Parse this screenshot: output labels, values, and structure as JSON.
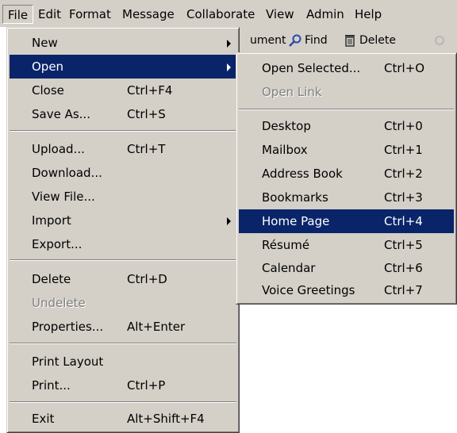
{
  "menubar": {
    "items": [
      "File",
      "Edit",
      "Format",
      "Message",
      "Collaborate",
      "View",
      "Admin",
      "Help"
    ]
  },
  "toolbar": {
    "partial_label": "ument",
    "find_label": "Find",
    "delete_label": "Delete",
    "icons": [
      "find-icon",
      "delete-icon",
      "partial-icon"
    ]
  },
  "file_menu": {
    "groups": [
      [
        {
          "label": "New",
          "shortcut": "",
          "submenu": true
        },
        {
          "label": "Open",
          "shortcut": "",
          "submenu": true,
          "selected": true
        },
        {
          "label": "Close",
          "shortcut": "Ctrl+F4"
        },
        {
          "label": "Save As...",
          "shortcut": "Ctrl+S"
        }
      ],
      [
        {
          "label": "Upload...",
          "shortcut": "Ctrl+T"
        },
        {
          "label": "Download...",
          "shortcut": ""
        },
        {
          "label": "View File...",
          "shortcut": ""
        },
        {
          "label": "Import",
          "shortcut": "",
          "submenu": true
        },
        {
          "label": "Export...",
          "shortcut": ""
        }
      ],
      [
        {
          "label": "Delete",
          "shortcut": "Ctrl+D"
        },
        {
          "label": "Undelete",
          "shortcut": "",
          "disabled": true
        },
        {
          "label": "Properties...",
          "shortcut": "Alt+Enter"
        }
      ],
      [
        {
          "label": "Print Layout",
          "shortcut": ""
        },
        {
          "label": "Print...",
          "shortcut": "Ctrl+P"
        }
      ],
      [
        {
          "label": "Exit",
          "shortcut": "Alt+Shift+F4"
        }
      ]
    ]
  },
  "open_menu": {
    "groups": [
      [
        {
          "label": "Open Selected...",
          "shortcut": "Ctrl+O"
        },
        {
          "label": "Open Link",
          "shortcut": "",
          "disabled": true
        }
      ],
      [
        {
          "label": "Desktop",
          "shortcut": "Ctrl+0"
        },
        {
          "label": "Mailbox",
          "shortcut": "Ctrl+1"
        },
        {
          "label": "Address Book",
          "shortcut": "Ctrl+2"
        },
        {
          "label": "Bookmarks",
          "shortcut": "Ctrl+3"
        },
        {
          "label": "Home Page",
          "shortcut": "Ctrl+4",
          "selected": true
        },
        {
          "label": "Résumé",
          "shortcut": "Ctrl+5"
        },
        {
          "label": "Calendar",
          "shortcut": "Ctrl+6"
        },
        {
          "label": "Voice Greetings",
          "shortcut": "Ctrl+7"
        }
      ]
    ]
  },
  "colors": {
    "menu_face": "#d4d0c8",
    "selection": "#0a246a",
    "disabled_text": "#808080"
  }
}
